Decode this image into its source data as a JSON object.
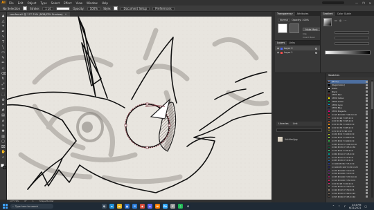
{
  "menubar": {
    "logo": "Ai",
    "items": [
      "File",
      "Edit",
      "Object",
      "Type",
      "Select",
      "Effect",
      "View",
      "Window",
      "Help"
    ],
    "window_controls": [
      "—",
      "❐",
      "✕"
    ]
  },
  "controlbar": {
    "selection_label": "No Selection",
    "stroke_label": "Stroke:",
    "stroke_value": "1 pt",
    "opacity_label": "Opacity:",
    "opacity_value": "100%",
    "style_label": "Style:",
    "doc_setup_label": "Document Setup",
    "preferences_label": "Preferences"
  },
  "document_tab": {
    "title": "comfox.ai* @ 177.79% (RGB/CPU Preview)"
  },
  "toolbar": {
    "tools": [
      {
        "name": "selection-tool",
        "icon": "▲"
      },
      {
        "name": "direct-selection-tool",
        "icon": "△"
      },
      {
        "name": "magic-wand-tool",
        "icon": "✦"
      },
      {
        "name": "pen-tool",
        "icon": "✒"
      },
      {
        "name": "curvature-tool",
        "icon": "∿"
      },
      {
        "name": "type-tool",
        "icon": "T"
      },
      {
        "name": "line-tool",
        "icon": "╲"
      },
      {
        "name": "rectangle-tool",
        "icon": "▭"
      },
      {
        "name": "paintbrush-tool",
        "icon": "✎"
      },
      {
        "name": "pencil-tool",
        "icon": "✏"
      },
      {
        "name": "shaper-tool",
        "icon": "◇"
      },
      {
        "name": "eraser-tool",
        "icon": "⌫"
      },
      {
        "name": "rotate-tool",
        "icon": "↻"
      },
      {
        "name": "scale-tool",
        "icon": "⤢"
      },
      {
        "name": "width-tool",
        "icon": "⇔"
      },
      {
        "name": "free-transform-tool",
        "icon": "⬚"
      },
      {
        "name": "shape-builder-tool",
        "icon": "⊕"
      },
      {
        "name": "perspective-grid-tool",
        "icon": "⌗"
      },
      {
        "name": "mesh-tool",
        "icon": "#"
      },
      {
        "name": "gradient-tool",
        "icon": "▤"
      },
      {
        "name": "eyedropper-tool",
        "icon": "⌀"
      },
      {
        "name": "blend-tool",
        "icon": "∞"
      },
      {
        "name": "symbol-sprayer-tool",
        "icon": "✺"
      },
      {
        "name": "column-graph-tool",
        "icon": "▥"
      },
      {
        "name": "artboard-tool",
        "icon": "▢"
      },
      {
        "name": "slice-tool",
        "icon": "⌧"
      },
      {
        "name": "hand-tool",
        "icon": "✋"
      },
      {
        "name": "zoom-tool",
        "icon": "⌕"
      }
    ]
  },
  "statusbar": {
    "zoom": "177.79%",
    "angle": "0°",
    "artboard": "1",
    "tool": "Shape Builder"
  },
  "panels": {
    "transparency_tabs": [
      "Transparency",
      "Attributes"
    ],
    "blend_mode": "Normal",
    "opacity": "Opacity: 100%",
    "make_mask": "Make Mask",
    "clip": "Clip",
    "invert_mask": "Invert Mask",
    "gradient_tabs": [
      "Gradient",
      "Color Guide"
    ],
    "layers_tabs": [
      "Layers",
      "Links"
    ],
    "layers": [
      {
        "name": "Layer 2",
        "color": "#4f6bff",
        "selected": true
      },
      {
        "name": "Layer 1",
        "color": "#ff4f4f",
        "selected": false
      }
    ],
    "libraries_header": [
      "Libraries",
      "Link"
    ],
    "library_item": "Untitled.jpg",
    "swatches_title": "Swatches",
    "swatches": [
      {
        "name": "[None]",
        "color": "#ffffff",
        "selected": true
      },
      {
        "name": "[Registration]",
        "color": "#000000"
      },
      {
        "name": "White",
        "color": "#ffffff"
      },
      {
        "name": "Black",
        "color": "#000000"
      },
      {
        "name": "CMYK Red",
        "color": "#e31e24"
      },
      {
        "name": "CMYK Yellow",
        "color": "#fff200"
      },
      {
        "name": "CMYK Green",
        "color": "#00a651"
      },
      {
        "name": "CMYK Cyan",
        "color": "#00aeef"
      },
      {
        "name": "CMYK Blue",
        "color": "#2e3192"
      },
      {
        "name": "CMYK Magenta",
        "color": "#ec008c"
      },
      {
        "name": "C=15 M=100 Y=90 K=10",
        "color": "#be1e2d"
      },
      {
        "name": "C=0 M=90 Y=85 K=0",
        "color": "#ef4136"
      },
      {
        "name": "C=0 M=80 Y=95 K=0",
        "color": "#f15a29"
      },
      {
        "name": "C=0 M=50 Y=100 K=0",
        "color": "#f7941d"
      },
      {
        "name": "C=0 M=35 Y=85 K=0",
        "color": "#fbb040"
      },
      {
        "name": "C=5 M=0 Y=90 K=0",
        "color": "#f9ed32"
      },
      {
        "name": "C=20 M=0 Y=100 K=0",
        "color": "#d7df23"
      },
      {
        "name": "C=50 M=0 Y=100 K=0",
        "color": "#8dc63f"
      },
      {
        "name": "C=75 M=0 Y=100 K=0",
        "color": "#39b54a"
      },
      {
        "name": "C=85 M=10 Y=100 K=10",
        "color": "#009444"
      },
      {
        "name": "C=90 M=30 Y=95 K=30",
        "color": "#006838"
      },
      {
        "name": "C=75 M=0 Y=75 K=0",
        "color": "#2bb673"
      },
      {
        "name": "C=80 M=10 Y=45 K=0",
        "color": "#00a79d"
      },
      {
        "name": "C=70 M=15 Y=0 K=0",
        "color": "#27aae1"
      },
      {
        "name": "C=85 M=50 Y=0 K=0",
        "color": "#1c75bc"
      },
      {
        "name": "C=100 M=95 Y=5 K=0",
        "color": "#2b3990"
      },
      {
        "name": "C=100 M=100 Y=25 K=25",
        "color": "#262262"
      },
      {
        "name": "C=75 M=100 Y=0 K=0",
        "color": "#662d91"
      },
      {
        "name": "C=50 M=100 Y=0 K=0",
        "color": "#92278f"
      },
      {
        "name": "C=35 M=100 Y=35 K=10",
        "color": "#9e1f63"
      },
      {
        "name": "C=10 M=100 Y=50 K=0",
        "color": "#da1c5c"
      },
      {
        "name": "C=0 M=95 Y=20 K=0",
        "color": "#ee2a7b"
      },
      {
        "name": "C=25 M=25 Y=40 K=0",
        "color": "#c2b59b"
      },
      {
        "name": "C=40 M=45 Y=50 K=5",
        "color": "#998675"
      },
      {
        "name": "C=50 M=50 Y=60 K=25",
        "color": "#736357"
      },
      {
        "name": "C=55 M=60 Y=65 K=40",
        "color": "#594a42"
      }
    ]
  },
  "taskbar": {
    "search_placeholder": "Type here to search",
    "apps": [
      {
        "name": "task-view",
        "label": "⧉",
        "color": "#3a4a5a"
      },
      {
        "name": "edge",
        "label": "e",
        "color": "#1f8fd6"
      },
      {
        "name": "file-explorer",
        "label": "▬",
        "color": "#e6b422"
      },
      {
        "name": "store",
        "label": "▣",
        "color": "#2a6fd1"
      },
      {
        "name": "mail",
        "label": "✉",
        "color": "#2b7bd6"
      },
      {
        "name": "chrome",
        "label": "◉",
        "color": "#d64b3a"
      },
      {
        "name": "discord",
        "label": "◈",
        "color": "#5865f2"
      },
      {
        "name": "illustrator",
        "label": "Ai",
        "color": "#ff7c00"
      },
      {
        "name": "photoshop",
        "label": "Ps",
        "color": "#31a8ff"
      },
      {
        "name": "clip-studio",
        "label": "C",
        "color": "#9c9c9c"
      },
      {
        "name": "spotify",
        "label": "♫",
        "color": "#1db954"
      },
      {
        "name": "steam",
        "label": "S",
        "color": "#1b2838"
      }
    ],
    "time": "3:53 PM",
    "date": "6/21/2021"
  }
}
